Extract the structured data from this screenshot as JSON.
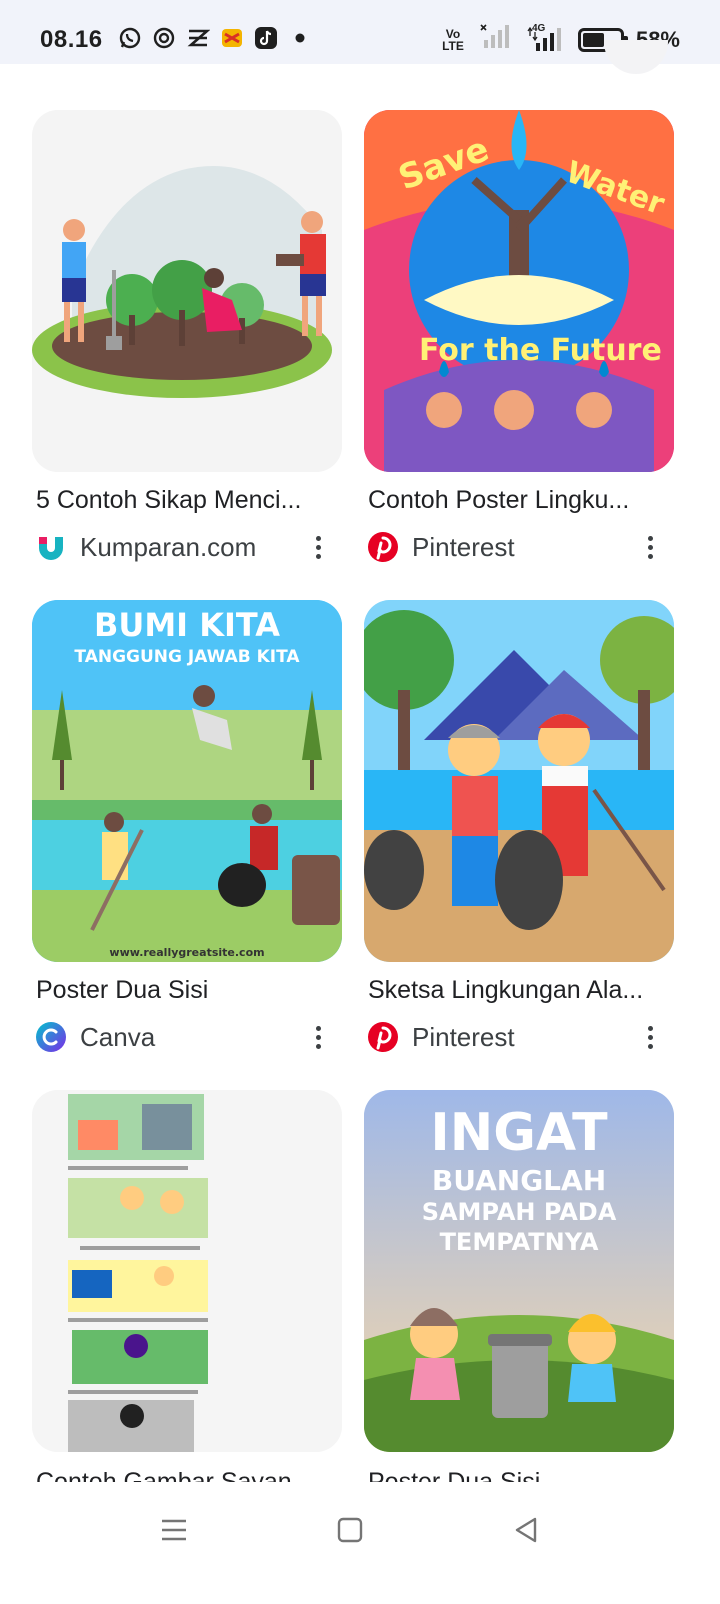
{
  "status_bar": {
    "time": "08.16",
    "network_label": "Vo\nLTE",
    "network_gen": "4G",
    "battery_percent": "58%",
    "battery_level": 0.58,
    "app_icons": [
      "whatsapp-icon",
      "signal-app-icon",
      "capcut-icon",
      "game-app-icon",
      "tiktok-icon",
      "notification-dot-icon"
    ]
  },
  "results": [
    {
      "title": "5 Contoh Sikap Menci...",
      "source": "Kumparan.com",
      "source_icon": "kumparan-icon",
      "image": "illustration-people-planting-trees"
    },
    {
      "title": "Contoh Poster Lingku...",
      "source": "Pinterest",
      "source_icon": "pinterest-icon",
      "image": "poster-save-water"
    },
    {
      "title": "Poster Dua Sisi",
      "source": "Canva",
      "source_icon": "canva-icon",
      "image": "poster-bumi-kita",
      "image_text": [
        "BUMI KITA",
        "TANGGUNG JAWAB KITA",
        "www.reallygreatsite.com"
      ]
    },
    {
      "title": "Sketsa Lingkungan Ala...",
      "source": "Pinterest",
      "source_icon": "pinterest-icon",
      "image": "sketch-kids-cleaning-river"
    },
    {
      "title": "Contoh Gambar Sayan...",
      "source": "",
      "source_icon": "",
      "image": "document-environment-examples"
    },
    {
      "title": "Poster Dua Sisi",
      "source": "",
      "source_icon": "",
      "image": "poster-ingat-buang-sampah",
      "image_text": [
        "INGAT",
        "BUANGLAH",
        "SAMPAH PADA",
        "TEMPATNYA"
      ]
    }
  ],
  "colors": {
    "status_bg": "#f1f3fa",
    "pinterest_red": "#e60023",
    "kumparan_teal": "#17b3c1",
    "canva_purple": "#7d2ae8"
  },
  "nav_bar": {
    "icons": [
      "menu-lines-icon",
      "home-square-icon",
      "back-triangle-icon"
    ]
  }
}
